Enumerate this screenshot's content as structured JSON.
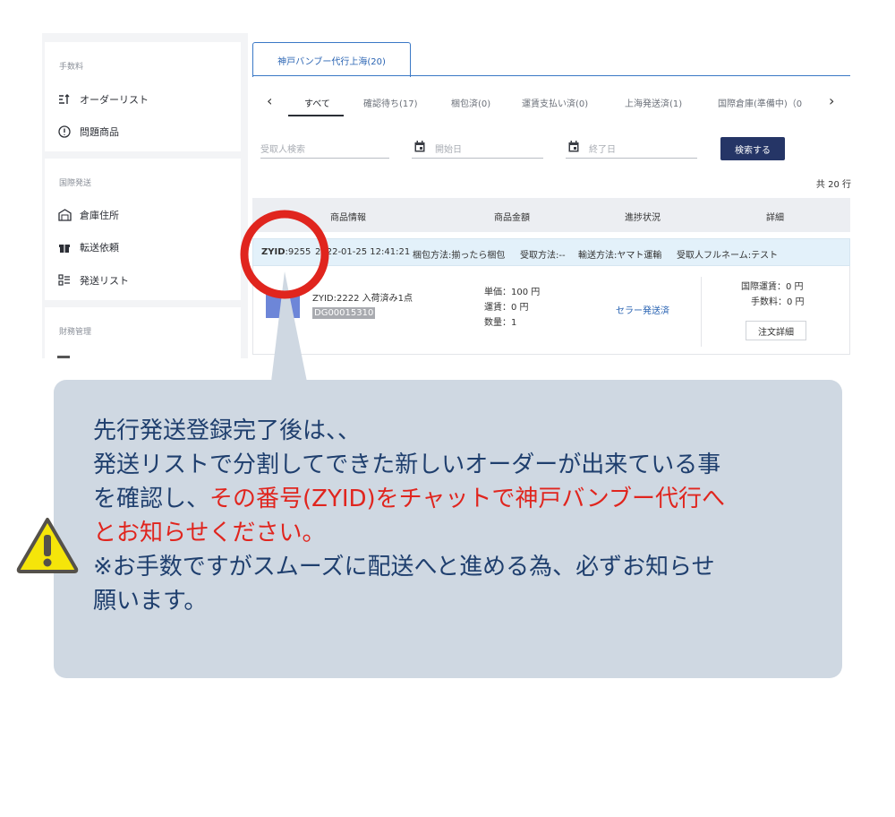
{
  "sidebar": {
    "sections": [
      {
        "title": "手数料",
        "items": [
          {
            "label": "オーダーリスト",
            "icon": "sort-icon"
          },
          {
            "label": "問題商品",
            "icon": "alert-circle-icon"
          }
        ]
      },
      {
        "title": "国際発送",
        "items": [
          {
            "label": "倉庫住所",
            "icon": "warehouse-icon"
          },
          {
            "label": "転送依頼",
            "icon": "gift-icon"
          },
          {
            "label": "発送リスト",
            "icon": "list-icon"
          }
        ]
      },
      {
        "title": "財務管理",
        "items": []
      }
    ]
  },
  "store_tab": {
    "label": "神戸バンブー代行上海(20)"
  },
  "status_tabs": [
    "すべて",
    "確認待ち(17)",
    "梱包済(0)",
    "運賃支払い済(0)",
    "上海発送済(1)",
    "国際倉庫(準備中)（0"
  ],
  "status_nav": {
    "prev": "‹",
    "next": "›"
  },
  "filters": {
    "recipient_placeholder": "受取人検索",
    "start_placeholder": "開始日",
    "end_placeholder": "終了日",
    "search_label": "検索する"
  },
  "total": "共 20 行",
  "columns": [
    "商品情報",
    "商品金額",
    "進捗状況",
    "詳細"
  ],
  "order": {
    "zyid_label": "ZYID",
    "zyid_value": ":9255",
    "datetime": "2022-01-25 12:41:21",
    "packing": "梱包方法:揃ったら梱包",
    "receive": "受取方法:--",
    "shipping": "輸送方法:ヤマト運輸",
    "recipient": "受取人フルネーム:テスト"
  },
  "item": {
    "title": "ZYID:2222 入荷済み1点",
    "code": "DG00015310",
    "unit_price": "単価：100 円",
    "freight": "運賃：0 円",
    "quantity": "数量：1",
    "status": "セラー発送済",
    "intl_freight": "国際運賃：0 円",
    "fee": "手数料：0 円",
    "detail_button": "注文詳細"
  },
  "callout": {
    "line1": "先行発送登録完了後は、、",
    "line2": "発送リストで分割してできた新しいオーダーが出来ている事",
    "line3a": "を確認し、",
    "line3b": "その番号(ZYID)をチャットで神戸バンブー代行へ",
    "line4": "とお知らせください。",
    "line5": "※お手数ですがスムーズに配送へと進める為、必ずお知らせ",
    "line6": "願います。"
  },
  "colors": {
    "accent": "#3a78c6",
    "button": "#253566",
    "highlight_circle": "#e0251e",
    "callout_bg": "#cfd8e2",
    "callout_text": "#1f3f6e",
    "warning": "#f5e50a"
  }
}
